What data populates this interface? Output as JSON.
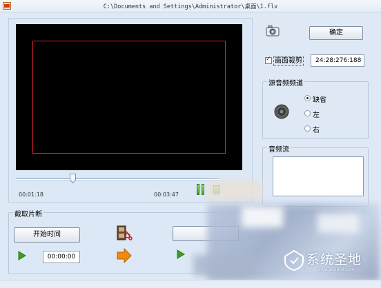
{
  "window": {
    "title": "C:\\Documents and Settings\\Administrator\\桌面\\1.flv"
  },
  "player": {
    "current_time": "00:01:18",
    "total_time": "00:03:47",
    "progress_fraction": 0.28
  },
  "crop": {
    "ok_label": "确定",
    "checkbox_label": "画面裁剪",
    "checked": true,
    "value": "24:28:276:188"
  },
  "channel": {
    "title": "源音频频道",
    "options": [
      "缺省",
      "左",
      "右"
    ],
    "selected": "缺省"
  },
  "stream": {
    "title": "音频流"
  },
  "clip": {
    "title": "截取片断",
    "start_button": "开始时间",
    "start_value": "00:00:00"
  },
  "watermark": {
    "text": "系统圣地",
    "url": "www.285868.com"
  },
  "colors": {
    "window_bg": "#dfe9f6",
    "crop_rect": "#e0202a",
    "play_green": "#3e9d21",
    "arrow_orange": "#f08a10"
  }
}
